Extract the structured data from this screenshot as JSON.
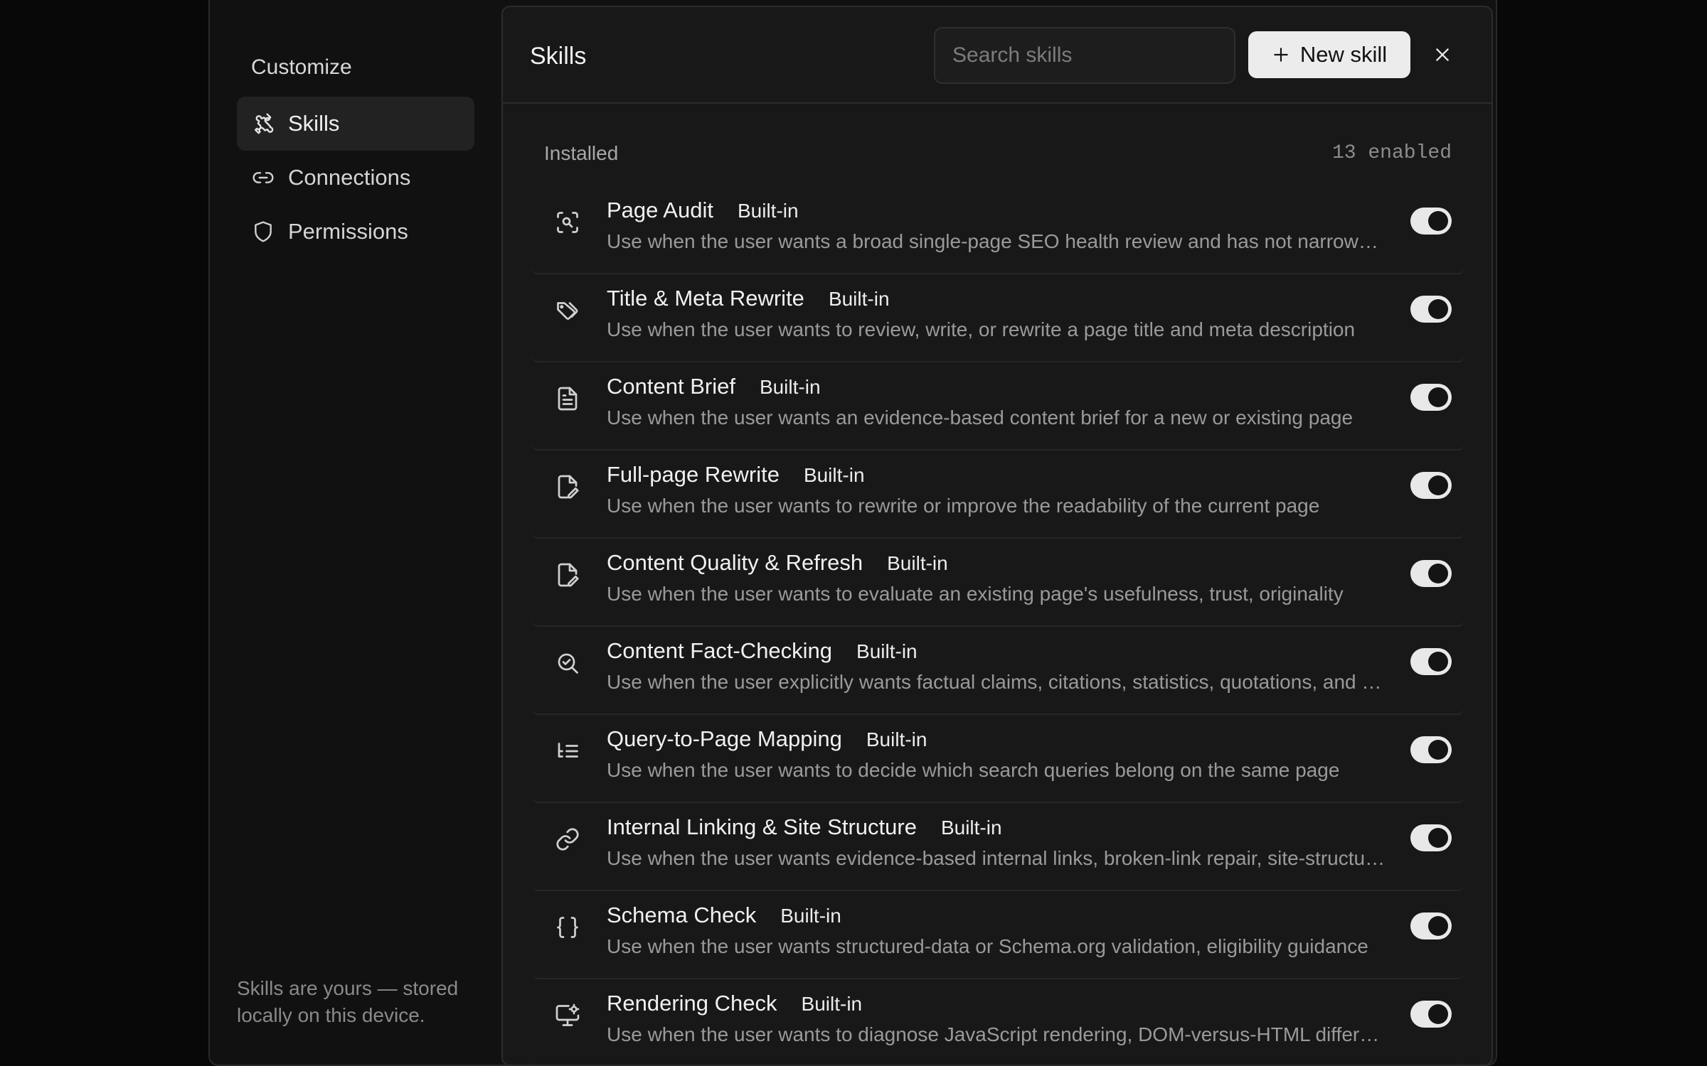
{
  "sidebar": {
    "heading": "Customize",
    "items": [
      {
        "label": "Skills",
        "icon": "puzzle-icon",
        "active": true
      },
      {
        "label": "Connections",
        "icon": "link-icon",
        "active": false
      },
      {
        "label": "Permissions",
        "icon": "shield-icon",
        "active": false
      }
    ],
    "footer": "Skills are yours — stored locally on this device."
  },
  "panel": {
    "title": "Skills",
    "search_placeholder": "Search skills",
    "new_button_label": "New skill",
    "close_icon": "close-icon",
    "section_label": "Installed",
    "section_count": "13 enabled"
  },
  "skills": [
    {
      "name": "Page Audit",
      "badge": "Built-in",
      "icon": "scan-search-icon",
      "enabled": true,
      "description": "Use when the user wants a broad single-page SEO health review and has not narrowed the task"
    },
    {
      "name": "Title & Meta Rewrite",
      "badge": "Built-in",
      "icon": "tags-icon",
      "enabled": true,
      "description": "Use when the user wants to review, write, or rewrite a page title and meta description"
    },
    {
      "name": "Content Brief",
      "badge": "Built-in",
      "icon": "document-icon",
      "enabled": true,
      "description": "Use when the user wants an evidence-based content brief for a new or existing page"
    },
    {
      "name": "Full-page Rewrite",
      "badge": "Built-in",
      "icon": "file-edit-icon",
      "enabled": true,
      "description": "Use when the user wants to rewrite or improve the readability of the current page"
    },
    {
      "name": "Content Quality & Refresh",
      "badge": "Built-in",
      "icon": "file-edit-icon",
      "enabled": true,
      "description": "Use when the user wants to evaluate an existing page's usefulness, trust, originality"
    },
    {
      "name": "Content Fact-Checking",
      "badge": "Built-in",
      "icon": "search-check-icon",
      "enabled": true,
      "description": "Use when the user explicitly wants factual claims, citations, statistics, quotations, and sources verified"
    },
    {
      "name": "Query-to-Page Mapping",
      "badge": "Built-in",
      "icon": "list-tree-icon",
      "enabled": true,
      "description": "Use when the user wants to decide which search queries belong on the same page"
    },
    {
      "name": "Internal Linking & Site Structure",
      "badge": "Built-in",
      "icon": "link-icon",
      "enabled": true,
      "description": "Use when the user wants evidence-based internal links, broken-link repair, site-structure review"
    },
    {
      "name": "Schema Check",
      "badge": "Built-in",
      "icon": "braces-icon",
      "enabled": true,
      "description": "Use when the user wants structured-data or Schema.org validation, eligibility guidance"
    },
    {
      "name": "Rendering Check",
      "badge": "Built-in",
      "icon": "monitor-cog-icon",
      "enabled": true,
      "description": "Use when the user wants to diagnose JavaScript rendering, DOM-versus-HTML differences"
    }
  ]
}
